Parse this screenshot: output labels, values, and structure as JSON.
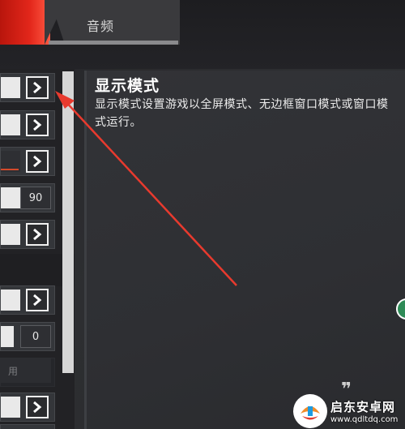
{
  "tabs": {
    "audio_label": "音频"
  },
  "info": {
    "title": "显示模式",
    "description": "显示模式设置游戏以全屏模式、无边框窗口模式或窗口模式运行。"
  },
  "settings": {
    "rows": [
      {
        "type": "arrow"
      },
      {
        "type": "arrow"
      },
      {
        "type": "arrow-bar"
      },
      {
        "type": "number",
        "value": "90"
      },
      {
        "type": "arrow"
      },
      {
        "type": "arrow"
      },
      {
        "type": "number",
        "value": "0"
      },
      {
        "type": "disabled",
        "value": "用"
      },
      {
        "type": "arrow"
      },
      {
        "type": "arrow"
      }
    ]
  },
  "watermark": {
    "name": "启东安卓网",
    "url": "www.qdltdq.com"
  },
  "colors": {
    "accent_red": "#e3271b",
    "panel_bg": "#2e2f33"
  }
}
